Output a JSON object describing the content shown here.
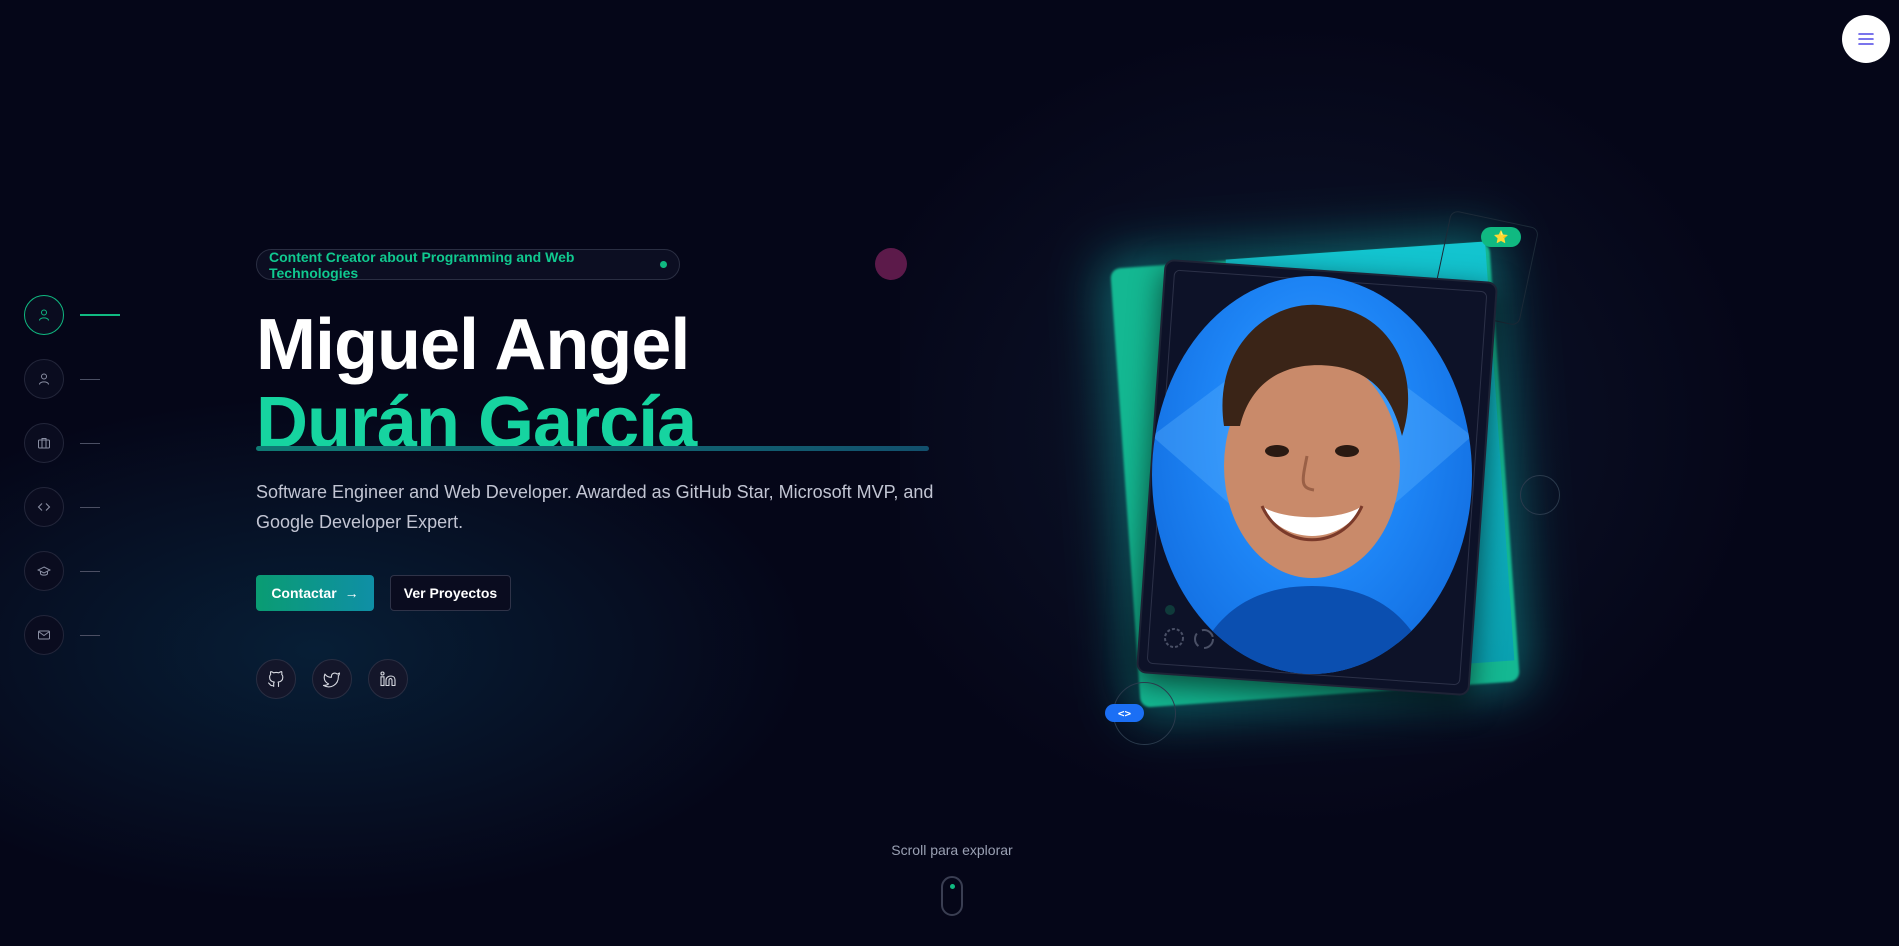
{
  "menu": {
    "icon": "hamburger-icon"
  },
  "side_nav": [
    {
      "icon": "user-icon",
      "active": true
    },
    {
      "icon": "user-icon",
      "active": false
    },
    {
      "icon": "briefcase-icon",
      "active": false
    },
    {
      "icon": "code-icon",
      "active": false
    },
    {
      "icon": "graduation-cap-icon",
      "active": false
    },
    {
      "icon": "mail-icon",
      "active": false
    }
  ],
  "hero": {
    "badge": "Content Creator about Programming and Web Technologies",
    "name_line1": "Miguel Angel",
    "name_line2": "Durán García",
    "subtitle": "Software Engineer and Web Developer. Awarded as GitHub Star, Microsoft MVP, and Google Developer Expert.",
    "primary_button": "Contactar",
    "secondary_button": "Ver Proyectos"
  },
  "social": [
    {
      "icon": "github-icon"
    },
    {
      "icon": "twitter-icon"
    },
    {
      "icon": "linkedin-icon"
    }
  ],
  "photo_card": {
    "star_badge": "⭐",
    "code_badge": "<>"
  },
  "scroll": {
    "label": "Scroll para explorar"
  },
  "colors": {
    "background": "#050618",
    "accent": "#10b981",
    "name_highlight": "#16d4a0",
    "photo_bg": "#1d84f5"
  }
}
